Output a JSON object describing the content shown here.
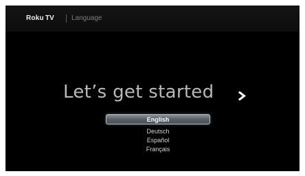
{
  "header": {
    "brand_roku": "Roku",
    "brand_tv": "TV",
    "breadcrumb": "Language"
  },
  "main": {
    "headline": "Let’s get started",
    "next_icon": "chevron-right-icon"
  },
  "languages": {
    "selected_index": 0,
    "items": [
      {
        "label": "English"
      },
      {
        "label": "Deutsch"
      },
      {
        "label": "Español"
      },
      {
        "label": "Français"
      }
    ]
  },
  "colors": {
    "background": "#000000",
    "header_bg": "#121212",
    "headline": "#b9b9b9",
    "selection": "#5f666e"
  }
}
